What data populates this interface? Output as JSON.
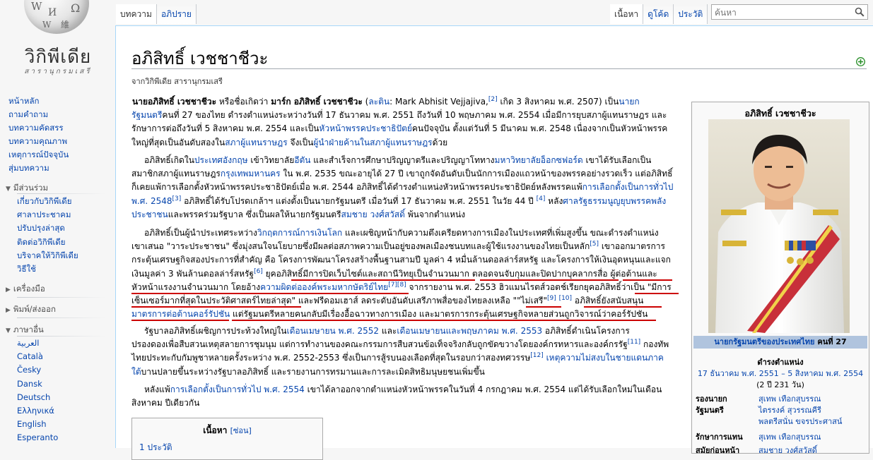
{
  "site": {
    "title": "วิกิพีเดีย",
    "tagline": "สารานุกรมเสรี",
    "globe_glyphs": [
      "W",
      "И",
      "維",
      "Ω",
      "W"
    ]
  },
  "nav": {
    "main": [
      "หน้าหลัก",
      "ถามคำถาม",
      "บทความคัดสรร",
      "บทความคุณภาพ",
      "เหตุการณ์ปัจจุบัน",
      "สุ่มบทความ"
    ],
    "participate_heading": "มีส่วนร่วม",
    "participate": [
      "เกี่ยวกับวิกิพีเดีย",
      "ศาลาประชาคม",
      "ปรับปรุงล่าสุด",
      "ติดต่อวิกิพีเดีย",
      "บริจาคให้วิกิพีเดีย",
      "วิธีใช้"
    ],
    "tools_heading": "เครื่องมือ",
    "print_heading": "พิมพ์/ส่งออก",
    "languages_heading": "ภาษาอื่น",
    "languages": [
      "العربية",
      "Català",
      "Česky",
      "Dansk",
      "Deutsch",
      "Ελληνικά",
      "English",
      "Esperanto"
    ]
  },
  "tabs": {
    "left": [
      "บทความ",
      "อภิปราย"
    ],
    "right": [
      "เนื้อหา",
      "ดูโค้ด",
      "ประวัติ"
    ],
    "search_placeholder": "ค้นหา"
  },
  "article": {
    "title": "อภิสิทธิ์ เวชชาชีวะ",
    "from": "จากวิกิพีเดีย สารานุกรมเสรี",
    "p1": {
      "l1a": "นายอภิสิทธิ์ เวชชาชีวะ",
      "l1b": " หรือชื่อเกิดว่า ",
      "l1c": "มาร์ก อภิสิทธิ์ เวชชาชีวะ",
      "l1d": " (",
      "l1e": "ละติน",
      "l1f": ": Mark Abhisit Vejjajiva,",
      "l1g": "[2]",
      "l1h": " เกิด 3 สิงหาคม พ.ศ. 2507) เป็น",
      "l1i": "นายก",
      "l2a": "รัฐมนตรี",
      "l2b": "คนที่ 27 ของไทย ดำรงตำแหน่งระหว่างวันที่ 17 ธันวาคม พ.ศ. 2551 ถึงวันที่ 10 พฤษภาคม พ.ศ. 2554 เมื่อมีการยุบสภาผู้แทนราษฎร และ",
      "l3a": "รักษาการต่อถึงวันที่ 5 สิงหาคม พ.ศ. 2554 และเป็น",
      "l3b": "หัวหน้าพรรคประชาธิปัตย์",
      "l3c": "คนปัจจุบัน ตั้งแต่วันที่ 5 มีนาคม พ.ศ. 2548 เนื่องจากเป็นหัวหน้าพรรค",
      "l4a": "ใหญ่ที่สุดเป็นอันดับสองใน",
      "l4b": "สภาผู้แทนราษฎร",
      "l4c": " จึงเป็น",
      "l4d": "ผู้นำฝ่ายค้านในสภาผู้แทนราษฎร",
      "l4e": "ด้วย"
    },
    "p2": {
      "l1a": "อภิสิทธิ์เกิดใน",
      "l1b": "ประเทศอังกฤษ",
      "l1c": " เข้าวิทยาลัย",
      "l1d": "อีตัน",
      "l1e": " และสำเร็จการศึกษาปริญญาตรีและปริญญาโททาง",
      "l1f": "มหาวิทยาลัยอ็อกซฟอร์ด",
      "l1g": " เขาได้รับเลือกเป็น",
      "l2a": "สมาชิกสภาผู้แทนราษฎร",
      "l2b": "กรุงเทพมหานคร",
      "l2c": " ใน พ.ศ. 2535 ขณะอายุได้ 27 ปี เขาถูกจัดอันดับเป็นนักการเมืองแถวหน้าของพรรคอย่างรวดเร็ว แต่อภิสิทธิ์",
      "l3a": "ก็เคยแพ้การเลือกตั้งหัวหน้าพรรคประชาธิปัตย์เมื่อ พ.ศ. 2544 อภิสิทธิ์ได้ดำรงตำแหน่งหัวหน้าพรรคประชาธิปัตย์หลังพรรคแพ้",
      "l3b": "การเลือกตั้งเป็นการทั่วไป",
      "l4a": "พ.ศ. 2548",
      "l4b": "[3]",
      "l4c": " อภิสิทธิ์ได้รับโปรดเกล้าฯ แต่งตั้งเป็นนายกรัฐมนตรี เมื่อวันที่ 17 ธันวาคม พ.ศ. 2551 ในวัย 44 ปี ",
      "l4d": "[4]",
      "l4e": " หลัง",
      "l4f": "ศาลรัฐธรรมนูญยุบพรรคพลัง",
      "l5a": "ประชาชน",
      "l5b": "และพรรคร่วมรัฐบาล ซึ่งเป็นผลให้นายกรัฐมนตรี",
      "l5c": "สมชาย วงศ์สวัสดิ์",
      "l5d": " พ้นจากตำแหน่ง"
    },
    "p3": {
      "l1a": "อภิสิทธิ์เป็นผู้นำประเทศระหว่าง",
      "l1b": "วิกฤตการณ์การเงินโลก",
      "l1c": " และเผชิญหน้ากับความตึงเครียดทางการเมืองในประเทศที่เพิ่มสูงขึ้น ขณะดำรงตำแหน่ง",
      "l2a": "เขาเสนอ \"วาระประชาชน\" ซึ่งมุ่งสนใจนโยบายซึ่งมีผลต่อสภาพความเป็นอยู่ของพลเมืองชนบทและผู้ใช้แรงงานของไทยเป็นหลัก",
      "l2b": "[5]",
      "l2c": " เขาออกมาตรการ",
      "l3a": "กระตุ้นเศรษฐกิจสองประการที่สำคัญ คือ โครงการพัฒนาโครงสร้างพื้นฐานสามปี มูลค่า 4 หมื่นล้านดอลล่าร์สหรัฐ และโครงการให้เงินอุดหนุนและแจก",
      "l4a": "เงินมูลค่า 3 พันล้านดอลล่าร์สหรัฐ",
      "l4b": "[6]",
      "l4c": " ยุคอภิสิทธิ์มีการปิดเว็บไซต์และสถานีวิทยุเป็นจำนวนมาก",
      "l4d": " ตลอดจนจับกุมและปิดปากบุคลากรสื่อ",
      "l4e": " ผู้ต่อต้านและ",
      "l5a": "หัวหน้าแรงงานจำนวนมาก โดยอ้าง",
      "l5b": "ความผิดต่อองค์พระมหากษัตริย์ไทย",
      "l5c": "[7][8]",
      "l5d": " จากรายงาน พ.ศ. 2553 ฮิวแมนไรตส์วอตช์เรียกยุคอภิสิทธิ์ว่าเป็น \"มีการ",
      "l6a": "เซ็นเซอร์มากที่สุดในประวัติศาสตร์ไทยล่าสุด\"",
      "l6b": " และฟรีดอมเฮาส์ ลดระดับอันดับเสรีภาพสื่อของไทยลงเหลือ \"",
      "l6c": "\"ไม่เสรี\"",
      "l6d": "[9]",
      "l6e": " ",
      "l6f": "[10]",
      "l6g": " อภิสิทธิ์ยังสนับสนุน",
      "l7a": "มาตรการต่อต้านคอร์รัปชัน",
      "l7b": " แต่รัฐมนตรีหลายคนกลับมีเรื่องอื้อฉาวทางการเมือง และมาตรการกระตุ้นเศรษฐกิจหลายส่วนถูกวิจารณ์ว่าคอร์รัปชัน"
    },
    "p4": {
      "l1a": "รัฐบาลอภิสิทธิ์เผชิญการประท้วงใหญ่ใน",
      "l1b": "เดือนเมษายน พ.ศ. 2552",
      "l1c": " และ",
      "l1d": "เดือนเมษายนและพฤษภาคม พ.ศ. 2553",
      "l1e": " อภิสิทธิ์ดำเนินโครงการ",
      "l2a": "ปรองดองเพื่อสืบสวนเหตุสลายการชุมนุม แต่การทำงานของคณะกรรมการสืบสวนข้อเท็จจริงกลับถูกขัดขวางโดยองค์กรทหารและองค์กรรัฐ",
      "l2b": "[11]",
      "l2c": " กองทัพ",
      "l3a": "ไทยประทะกับกัมพูชาหลายครั้งระหว่าง พ.ศ. 2552-2553 ซึ่งเป็นการสู้รบนองเลือดที่สุดในรอบกว่าสองทศวรรษ",
      "l3b": "[12]",
      "l3c": " ",
      "l3d": "เหตุความไม่สงบในชายแดนภาค",
      "l4a": "ใต้",
      "l4b": "บานปลายขึ้นระหว่างรัฐบาลอภิสิทธิ์ และรายงานการทรมานและการละเมิดสิทธิมนุษยชนเพิ่มขึ้น"
    },
    "p5": {
      "l1a": "หลังแพ้",
      "l1b": "การเลือกตั้งเป็นการทั่วไป พ.ศ. 2554",
      "l1c": " เขาได้ลาออกจากตำแหน่งหัวหน้าพรรคในวันที่ 4 กรกฎาคม พ.ศ. 2554 แต่ได้รับเลือกใหม่ในเดือน",
      "l2a": "สิงหาคม ปีเดียวกัน"
    },
    "toc": {
      "title": "เนื้อหา",
      "toggle": "[ซ่อน]",
      "item1": "1 ประวัติ"
    }
  },
  "infobox": {
    "title": "อภิสิทธิ์ เวชชาชีวะ",
    "caption_link": "นายกรัฐมนตรีของประเทศไทย",
    "caption_rest": " คนที่ 27",
    "term_heading": "ดำรงตำแหน่ง",
    "term": "17 ธันวาคม พ.ศ. 2551 – 5 สิงหาคม พ.ศ. 2554",
    "term_length": "(2 ปี 231 วัน)",
    "deputy_label1": "รองนายก",
    "deputy_label2": "รัฐมนตรี",
    "deputies": [
      "สุเทพ เทือกสุบรรณ",
      "ไตรรงค์ สุวรรณคีรี",
      "พลตรีสนั่น ขจรประศาสน์"
    ],
    "acting_label": "รักษาการแทน",
    "acting": "สุเทพ เทือกสุบรรณ",
    "prev_label": "สมัยก่อนหน้า",
    "prev": "สมชาย วงศ์สวัสดิ์"
  }
}
